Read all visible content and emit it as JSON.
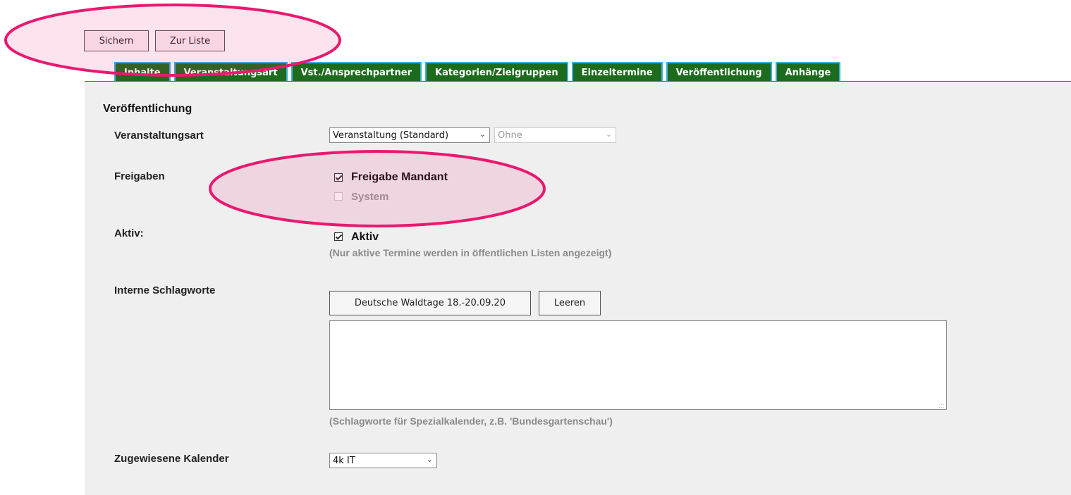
{
  "toolbar": {
    "save_label": "Sichern",
    "list_label": "Zur Liste"
  },
  "tabs": [
    {
      "label": "Inhalte"
    },
    {
      "label": "Veranstaltungsart"
    },
    {
      "label": "Vst./Ansprechpartner"
    },
    {
      "label": "Kategorien/Zielgruppen"
    },
    {
      "label": "Einzeltermine"
    },
    {
      "label": "Veröffentlichung"
    },
    {
      "label": "Anhänge"
    }
  ],
  "section": {
    "title": "Veröffentlichung"
  },
  "veranstaltungsart": {
    "label": "Veranstaltungsart",
    "select_value": "Veranstaltung (Standard)",
    "second_select_value": "Ohne"
  },
  "freigaben": {
    "label": "Freigaben",
    "mandant_label": "Freigabe Mandant",
    "mandant_checked": true,
    "system_label": "System",
    "system_checked": false
  },
  "aktiv": {
    "label": "Aktiv:",
    "checkbox_label": "Aktiv",
    "checked": true,
    "hint": "(Nur aktive Termine werden in öffentlichen Listen angezeigt)"
  },
  "schlagworte": {
    "label": "Interne Schlagworte",
    "tag_button": "Deutsche Waldtage 18.-20.09.20",
    "clear_button": "Leeren",
    "textarea_value": "",
    "hint": "(Schlagworte für Spezialkalender, z.B. 'Bundesgartenschau')"
  },
  "kalender": {
    "label": "Zugewiesene Kalender",
    "select_value": "4k IT"
  },
  "colors": {
    "tab_bg": "#1d6b1d",
    "tab_border": "#3fb0d8",
    "panel_bg": "#efefef",
    "annotation": "#e8196f"
  }
}
